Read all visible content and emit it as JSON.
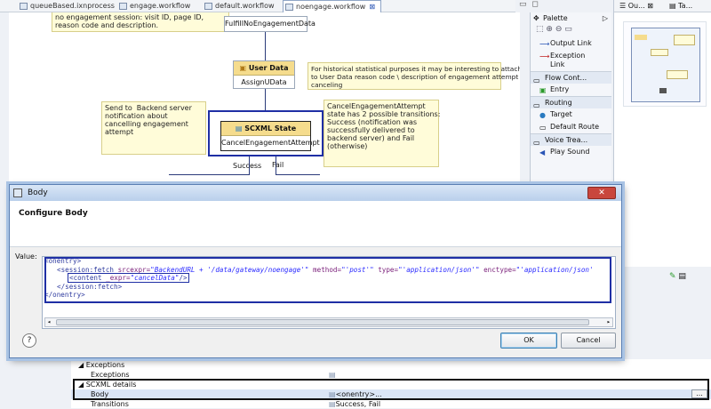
{
  "tabs": [
    {
      "label": "queueBased.ixnprocess",
      "active": false
    },
    {
      "label": "engage.workflow",
      "active": false
    },
    {
      "label": "default.workflow",
      "active": false
    },
    {
      "label": "noengage.workflow",
      "active": true
    }
  ],
  "canvas": {
    "note_top": "no engagement session: visit ID, page ID,\nreason code and description.",
    "node_fulfill": "FulfillNoEngagementData",
    "node_userdata": {
      "title": "User Data",
      "name": "AssignUData"
    },
    "note_userdata": "For historical statistical purposes it may be interesting to attach\nto User Data reason code \\ description of engagement attempt\ncanceling",
    "note_backend": "Send to  Backend server\nnotification about\ncancelling engagement\nattempt",
    "node_scxml": {
      "title": "SCXML State",
      "name": "CancelEngagementAttempt"
    },
    "note_transitions": "CancelEngagementAttempt\nstate has 2 possible transitions:\nSuccess (notification was\nsuccessfully delivered to\nbackend server) and Fail\n(otherwise)",
    "label_success": "Success",
    "label_fail": "Fail"
  },
  "palette": {
    "title": "Palette",
    "items": [
      {
        "label": "Output Link"
      },
      {
        "label": "Exception\nLink"
      }
    ],
    "sections": [
      {
        "label": "Flow Cont...",
        "items": [
          "Entry"
        ]
      },
      {
        "label": "Routing",
        "items": [
          "Target",
          "Default Route"
        ]
      },
      {
        "label": "Voice Trea...",
        "items": [
          "Play Sound"
        ]
      }
    ]
  },
  "outline": {
    "tab1": "Ou...",
    "tab2": "Ta..."
  },
  "dialog": {
    "title": "Body",
    "heading": "Configure Body",
    "value_label": "Value:",
    "code": {
      "l1": "<onentry>",
      "l2a": "<session:fetch",
      "l2b": "srcexpr=",
      "l2c": "\"BackendURL",
      "l2d": " + '/data/gateway/noengage'\"",
      "l2e": " method=",
      "l2f": "\"'post'\"",
      "l2g": " type=",
      "l2h": "\"'application/json'\"",
      "l2i": " enctype=",
      "l2j": "\"'application/json'",
      "l3a": "<content",
      "l3b": " _expr=",
      "l3c": "\"cancelData\"",
      "l3d": "/>",
      "l4": "</session:fetch>",
      "l5": "</onentry>"
    },
    "ok": "OK",
    "cancel": "Cancel",
    "help": "?"
  },
  "props": {
    "rows": [
      {
        "label": "Exceptions",
        "indent": 1,
        "value": ""
      },
      {
        "label": "Exceptions",
        "indent": 2,
        "value": ""
      },
      {
        "label": "SCXML details",
        "indent": 1,
        "value": ""
      },
      {
        "label": "Body",
        "indent": 2,
        "value": "<onentry>..."
      },
      {
        "label": "Transitions",
        "indent": 2,
        "value": "Success, Fail"
      }
    ],
    "browse": "..."
  }
}
